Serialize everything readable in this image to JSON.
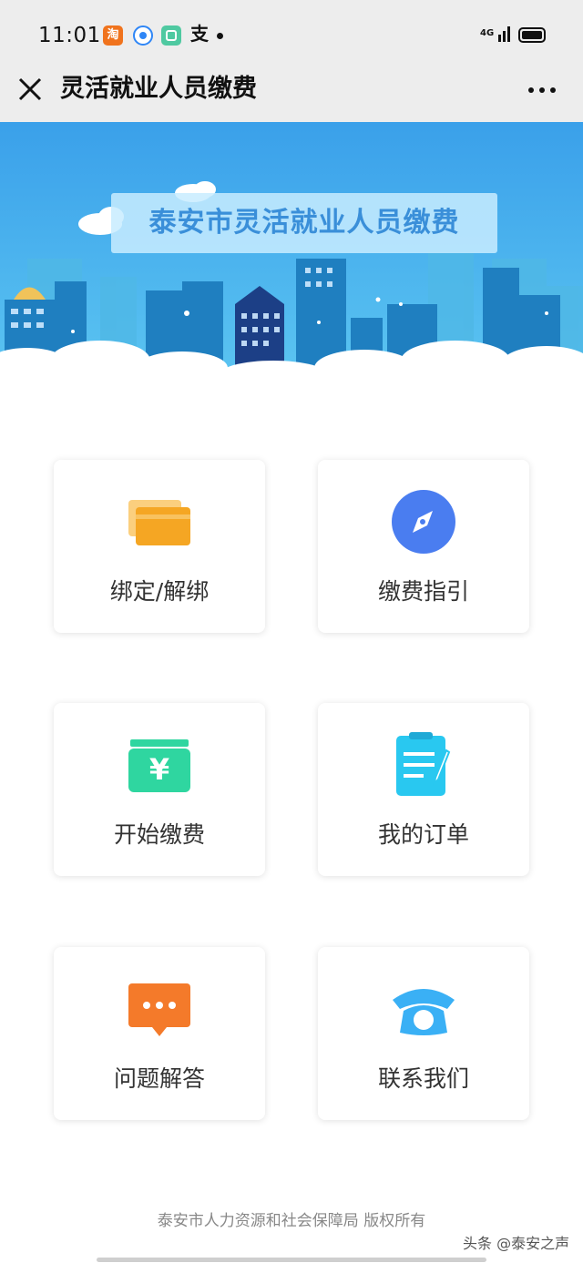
{
  "status_bar": {
    "time": "11:01",
    "app_icons": [
      "taobao-icon",
      "browser-icon",
      "green-app-icon",
      "alipay-icon"
    ],
    "taobao_glyph": "淘",
    "alipay_glyph": "支",
    "network": "4G"
  },
  "nav": {
    "title": "灵活就业人员缴费",
    "close_icon": "close-icon",
    "more_icon": "more-icon"
  },
  "banner": {
    "title": "泰安市灵活就业人员缴费"
  },
  "menu": [
    {
      "label": "绑定/解绑",
      "icon": "card-icon",
      "color": "#f5a623"
    },
    {
      "label": "缴费指引",
      "icon": "compass-icon",
      "color": "#4a7df0"
    },
    {
      "label": "开始缴费",
      "icon": "yuan-wallet-icon",
      "color": "#2fd6a0"
    },
    {
      "label": "我的订单",
      "icon": "clipboard-icon",
      "color": "#29c8f0"
    },
    {
      "label": "问题解答",
      "icon": "chat-bubble-icon",
      "color": "#f47a2a"
    },
    {
      "label": "联系我们",
      "icon": "telephone-icon",
      "color": "#3ab0f5"
    }
  ],
  "footer": {
    "copyright": "泰安市人力资源和社会保障局  版权所有",
    "watermark": "头条 @泰安之声"
  },
  "colors": {
    "chrome_bg": "#ededed",
    "banner_sky": "#3aa8ea"
  }
}
